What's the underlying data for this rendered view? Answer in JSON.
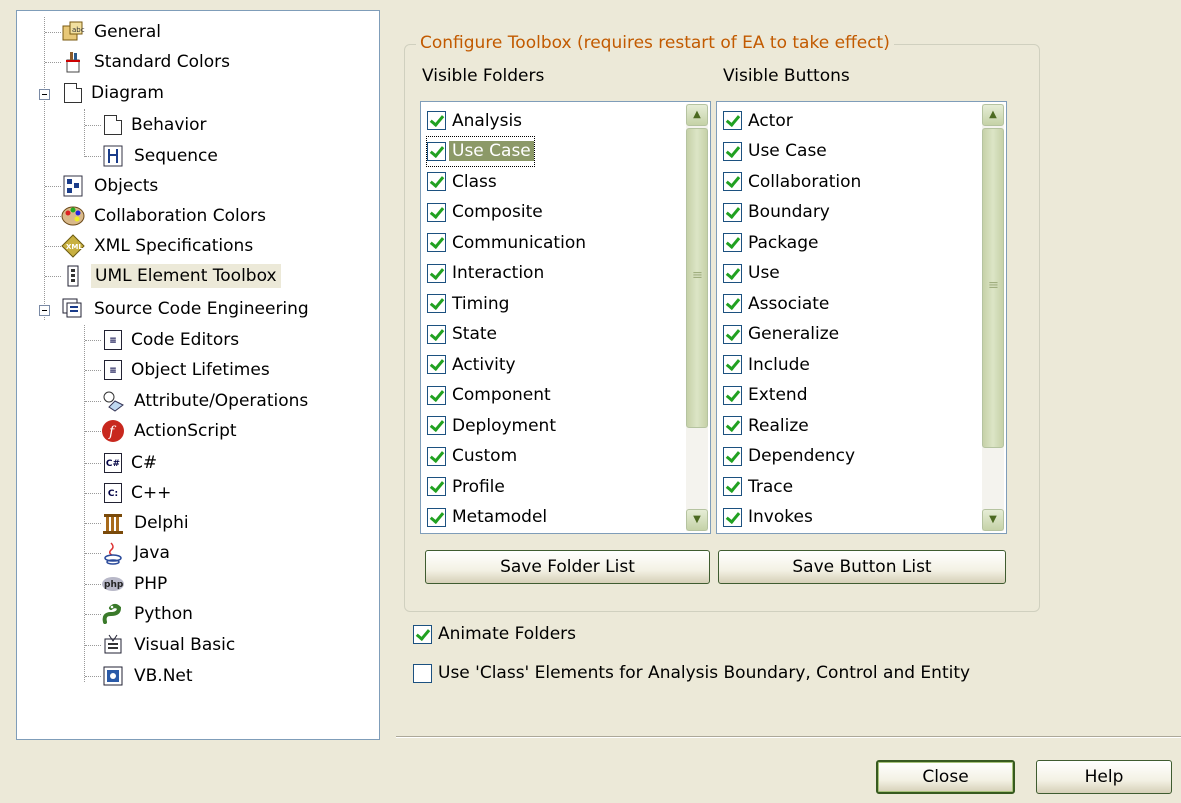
{
  "tree": {
    "items": [
      {
        "label": "General",
        "icon": "general-icon"
      },
      {
        "label": "Standard Colors",
        "icon": "paint-icon"
      },
      {
        "label": "Diagram",
        "icon": "diagram-icon"
      },
      {
        "label": "Behavior",
        "icon": "page-icon"
      },
      {
        "label": "Sequence",
        "icon": "sequence-icon"
      },
      {
        "label": "Objects",
        "icon": "objects-icon"
      },
      {
        "label": "Collaboration Colors",
        "icon": "palette-icon"
      },
      {
        "label": "XML Specifications",
        "icon": "xml-icon"
      },
      {
        "label": "UML Element Toolbox",
        "icon": "toolbox-icon"
      },
      {
        "label": "Source Code Engineering",
        "icon": "source-code-icon"
      },
      {
        "label": "Code Editors",
        "icon": "code-editor-icon"
      },
      {
        "label": "Object Lifetimes",
        "icon": "object-lifetimes-icon"
      },
      {
        "label": "Attribute/Operations",
        "icon": "attribute-operations-icon"
      },
      {
        "label": "ActionScript",
        "icon": "actionscript-icon"
      },
      {
        "label": "C#",
        "icon": "csharp-icon"
      },
      {
        "label": "C++",
        "icon": "cpp-icon"
      },
      {
        "label": "Delphi",
        "icon": "delphi-icon"
      },
      {
        "label": "Java",
        "icon": "java-icon"
      },
      {
        "label": "PHP",
        "icon": "php-icon"
      },
      {
        "label": "Python",
        "icon": "python-icon"
      },
      {
        "label": "Visual Basic",
        "icon": "visual-basic-icon"
      },
      {
        "label": "VB.Net",
        "icon": "vbnet-icon"
      }
    ],
    "selected": "UML Element Toolbox"
  },
  "toolbox": {
    "group_title": "Configure Toolbox (requires restart of EA to take effect)",
    "folders_header": "Visible Folders",
    "buttons_header": "Visible Buttons",
    "folders": [
      "Analysis",
      "Use Case",
      "Class",
      "Composite",
      "Communication",
      "Interaction",
      "Timing",
      "State",
      "Activity",
      "Component",
      "Deployment",
      "Custom",
      "Profile",
      "Metamodel"
    ],
    "selected_folder": "Use Case",
    "buttons": [
      "Actor",
      "Use Case",
      "Collaboration",
      "Boundary",
      "Package",
      "Use",
      "Associate",
      "Generalize",
      "Include",
      "Extend",
      "Realize",
      "Dependency",
      "Trace",
      "Invokes"
    ],
    "save_folder_label": "Save Folder List",
    "save_button_label": "Save Button List"
  },
  "options": {
    "animate_label": "Animate Folders",
    "animate_checked": true,
    "use_class_label": "Use 'Class' Elements for Analysis Boundary, Control and Entity",
    "use_class_checked": false
  },
  "footer": {
    "close_label": "Close",
    "help_label": "Help"
  },
  "colors": {
    "group_title": "#C25A00",
    "selection": "#8C9968",
    "dialog_bg": "#ECE9D8"
  }
}
